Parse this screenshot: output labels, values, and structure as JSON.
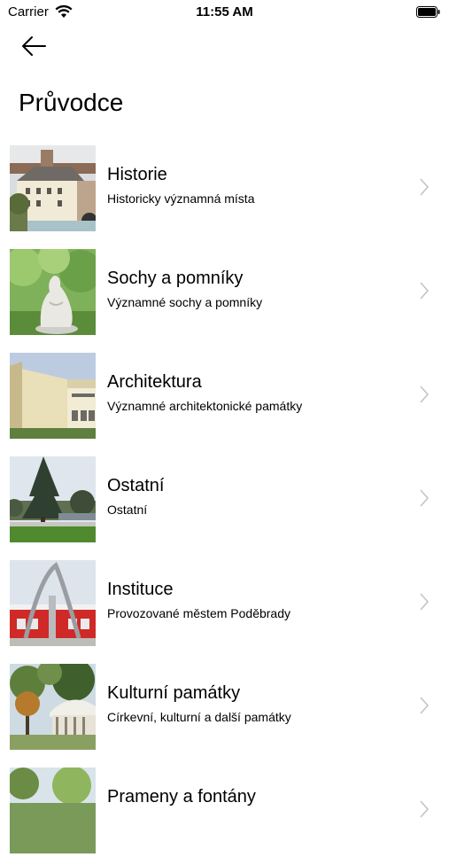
{
  "status_bar": {
    "carrier": "Carrier",
    "time": "11:55 AM"
  },
  "header": {
    "title": "Průvodce",
    "back_icon": "arrow-left-icon"
  },
  "items": [
    {
      "title": "Historie",
      "subtitle": "Historicky významná místa"
    },
    {
      "title": "Sochy a pomníky",
      "subtitle": "Významné sochy a pomníky"
    },
    {
      "title": "Architektura",
      "subtitle": "Významné architektonické památky"
    },
    {
      "title": "Ostatní",
      "subtitle": "Ostatní"
    },
    {
      "title": "Instituce",
      "subtitle": "Provozované městem Poděbrady"
    },
    {
      "title": "Kulturní památky",
      "subtitle": "Církevní, kulturní a další památky"
    },
    {
      "title": "Prameny a fontány",
      "subtitle": ""
    }
  ]
}
